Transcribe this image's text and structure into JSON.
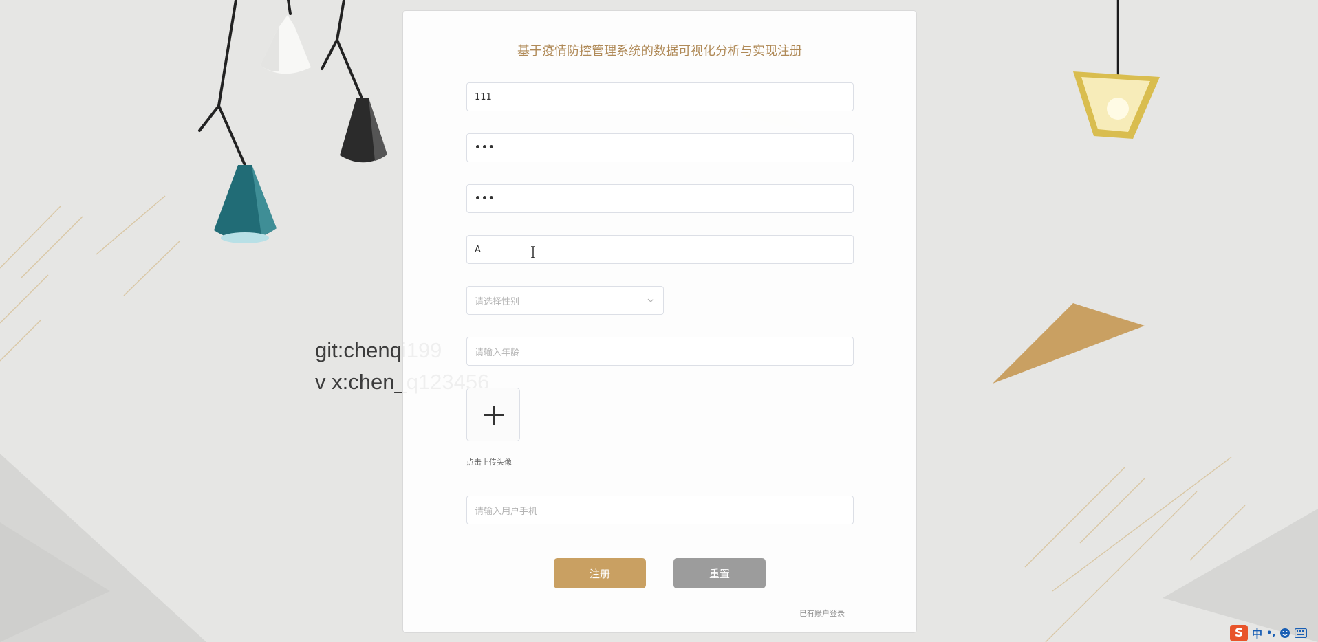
{
  "watermark": {
    "line1": "git:chenqi199",
    "line2": "v x:chen_q123456"
  },
  "form": {
    "title": "基于疫情防控管理系统的数据可视化分析与实现注册",
    "username_value": "111",
    "password_value": "•••",
    "confirm_password_value": "•••",
    "name_value": "A",
    "gender_placeholder": "请选择性别",
    "age_placeholder": "请输入年龄",
    "avatar_upload_hint": "点击上传头像",
    "phone_placeholder": "请输入用户手机",
    "register_label": "注册",
    "reset_label": "重置",
    "login_link": "已有账户登录"
  },
  "ime": {
    "logo": "S",
    "mode": "中",
    "punct": "•,",
    "emoji_icon": "smile-icon",
    "keyboard_icon": "keyboard-icon"
  },
  "colors": {
    "accent": "#c9a062",
    "title": "#b08a58",
    "reset": "#9c9c9c",
    "background": "#e6e6e4"
  }
}
